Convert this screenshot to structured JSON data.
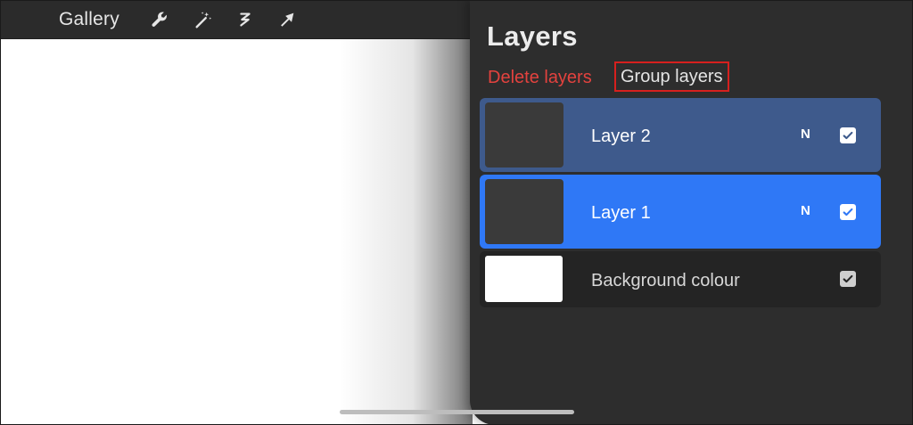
{
  "toolbar": {
    "gallery_label": "Gallery",
    "tools": [
      "wrench-icon",
      "magic-wand-icon",
      "selection-icon",
      "transform-arrow-icon"
    ]
  },
  "layers_panel": {
    "title": "Layers",
    "actions": {
      "delete_label": "Delete layers",
      "group_label": "Group layers"
    },
    "layers": [
      {
        "name": "Layer 2",
        "blend_mode": "N",
        "visible": true,
        "selected": true
      },
      {
        "name": "Layer 1",
        "blend_mode": "N",
        "visible": true,
        "selected": true
      },
      {
        "name": "Background colour",
        "visible": true
      }
    ]
  },
  "colors": {
    "toolbar_bg": "#2b2b2b",
    "panel_bg": "#2d2d2d",
    "layer_primary_selected": "#2f78f6",
    "layer_secondary_selected": "#3e5a8c",
    "delete_text": "#e3423e",
    "highlight_box": "#d6201e"
  }
}
